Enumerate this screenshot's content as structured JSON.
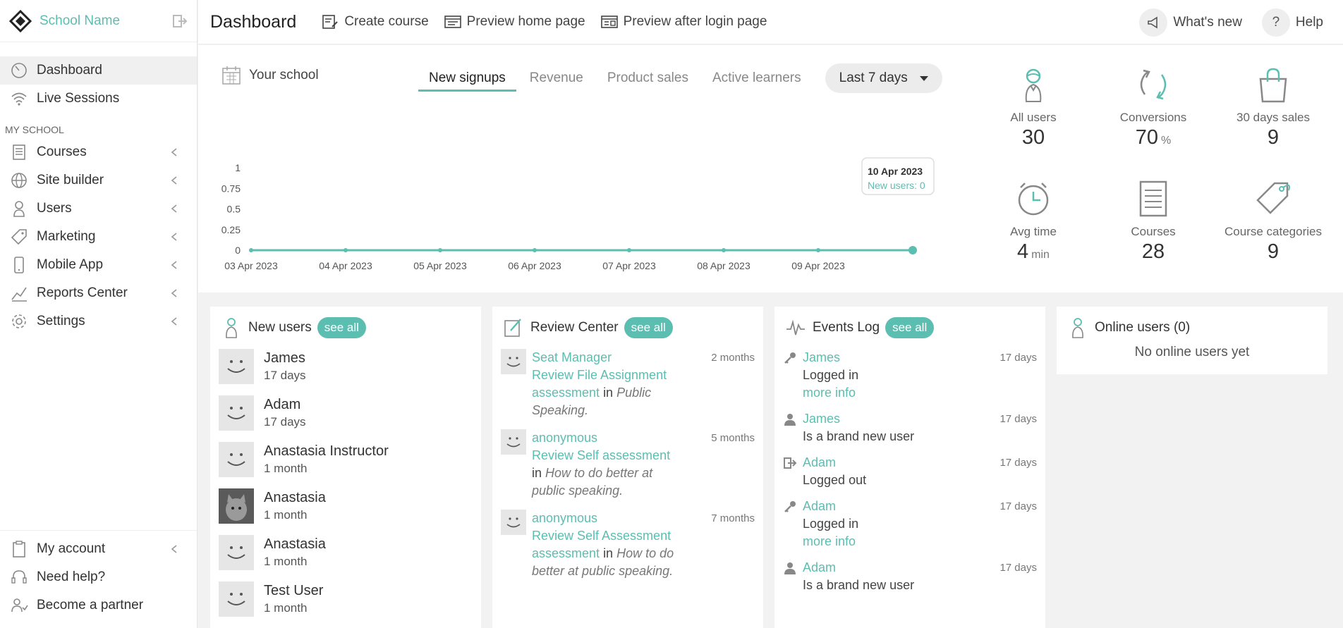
{
  "sidebar": {
    "school_name": "School Name",
    "items": [
      {
        "label": "Dashboard"
      },
      {
        "label": "Live Sessions"
      }
    ],
    "section_label": "MY SCHOOL",
    "school_items": [
      {
        "label": "Courses"
      },
      {
        "label": "Site builder"
      },
      {
        "label": "Users"
      },
      {
        "label": "Marketing"
      },
      {
        "label": "Mobile App"
      },
      {
        "label": "Reports Center"
      },
      {
        "label": "Settings"
      }
    ],
    "bottom_items": [
      {
        "label": "My account"
      },
      {
        "label": "Need help?"
      },
      {
        "label": "Become a partner"
      }
    ]
  },
  "topbar": {
    "title": "Dashboard",
    "create_course": "Create course",
    "preview_home": "Preview home page",
    "preview_after_login": "Preview after login page",
    "whats_new": "What's new",
    "help": "Help"
  },
  "overview": {
    "school_label": "Your school",
    "tabs": [
      "New signups",
      "Revenue",
      "Product sales",
      "Active learners"
    ],
    "period": "Last 7 days",
    "tooltip": {
      "date": "10 Apr 2023",
      "text": "New users: 0"
    }
  },
  "chart_data": {
    "type": "line",
    "categories": [
      "03 Apr 2023",
      "04 Apr 2023",
      "05 Apr 2023",
      "06 Apr 2023",
      "07 Apr 2023",
      "08 Apr 2023",
      "09 Apr 2023",
      "10 Apr 2023"
    ],
    "y_ticks": [
      "1",
      "0.75",
      "0.5",
      "0.25",
      "0"
    ],
    "ylim": [
      0,
      1
    ],
    "series": [
      {
        "values": [
          0,
          0,
          0,
          0,
          0,
          0,
          0,
          0
        ]
      }
    ],
    "color": "#5cbdb1",
    "grid": false
  },
  "stats": [
    {
      "label": "All users",
      "value": "30",
      "unit": "",
      "icon": "user-icon"
    },
    {
      "label": "Conversions",
      "value": "70",
      "unit": "%",
      "icon": "refresh-icon"
    },
    {
      "label": "30 days sales",
      "value": "9",
      "unit": "",
      "icon": "bag-icon"
    },
    {
      "label": "Avg time",
      "value": "4",
      "unit": "min",
      "icon": "clock-icon"
    },
    {
      "label": "Courses",
      "value": "28",
      "unit": "",
      "icon": "book-icon"
    },
    {
      "label": "Course categories",
      "value": "9",
      "unit": "",
      "icon": "tag-icon"
    }
  ],
  "new_users": {
    "title": "New users",
    "see_all": "see all",
    "rows": [
      {
        "name": "James",
        "when": "17 days"
      },
      {
        "name": "Adam",
        "when": "17 days"
      },
      {
        "name": "Anastasia Instructor",
        "when": "1 month"
      },
      {
        "name": "Anastasia",
        "when": "1 month"
      },
      {
        "name": "Anastasia",
        "when": "1 month"
      },
      {
        "name": "Test User",
        "when": "1 month"
      }
    ]
  },
  "review_center": {
    "title": "Review Center",
    "see_all": "see all",
    "rows": [
      {
        "user": "Seat Manager",
        "item": "Review File Assignment assessment",
        "in": "in",
        "course": "Public Speaking.",
        "time": "2 months"
      },
      {
        "user": "anonymous",
        "item": "Review Self assessment",
        "in": "in",
        "course": "How to do better at public speaking.",
        "time": "5 months"
      },
      {
        "user": "anonymous",
        "item": "Review Self Assessment assessment",
        "in": "in",
        "course": "How to do better at public speaking.",
        "time": "7 months"
      }
    ]
  },
  "events_log": {
    "title": "Events Log",
    "see_all": "see all",
    "more_info": "more info",
    "rows": [
      {
        "user": "James",
        "action": "Logged in",
        "time": "17 days",
        "icon": "key-icon",
        "more": true
      },
      {
        "user": "James",
        "action": "Is a brand new user",
        "time": "17 days",
        "icon": "person-icon",
        "more": false
      },
      {
        "user": "Adam",
        "action": "Logged out",
        "time": "17 days",
        "icon": "logout-icon",
        "more": false
      },
      {
        "user": "Adam",
        "action": "Logged in",
        "time": "17 days",
        "icon": "key-icon",
        "more": true
      },
      {
        "user": "Adam",
        "action": "Is a brand new user",
        "time": "17 days",
        "icon": "person-icon",
        "more": false
      }
    ]
  },
  "online_users": {
    "title": "Online users (0)",
    "empty": "No online users yet"
  }
}
